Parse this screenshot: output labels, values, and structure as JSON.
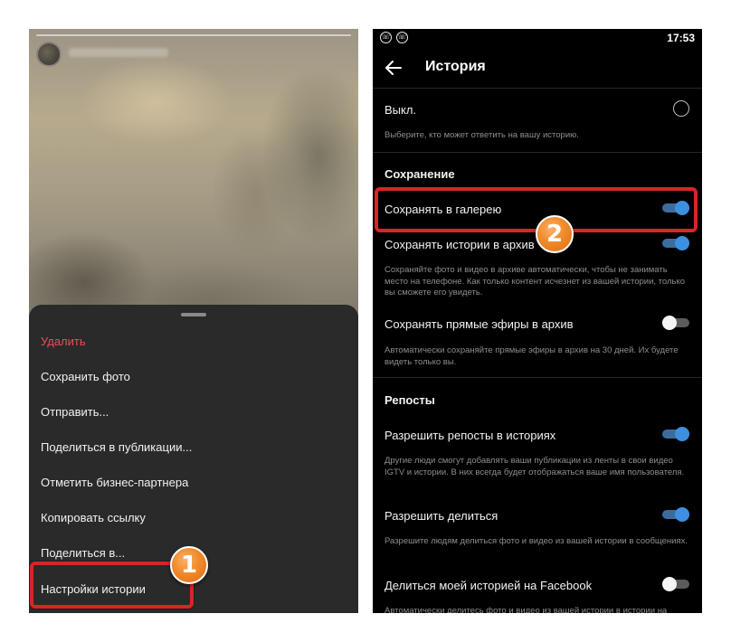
{
  "left_screen": {
    "menu_items": [
      "Удалить",
      "Сохранить фото",
      "Отправить...",
      "Поделиться в публикации...",
      "Отметить бизнес-партнера",
      "Копировать ссылку",
      "Поделиться в...",
      "Настройки истории"
    ],
    "annotation_number": "1"
  },
  "right_screen": {
    "status_time": "17:53",
    "title": "История",
    "off_label": "Выкл.",
    "off_desc": "Выберите, кто может ответить на вашу историю.",
    "section_saving": "Сохранение",
    "save_gallery": "Сохранять в галерею",
    "save_archive": "Сохранять истории в архив",
    "save_archive_desc": "Сохраняйте фото и видео в архиве автоматически, чтобы не занимать место на телефоне. Как только контент исчезнет из вашей истории, только вы сможете его увидеть.",
    "save_live": "Сохранять прямые эфиры в архив",
    "save_live_desc": "Автоматически сохраняйте прямые эфиры в архив на 30 дней. Их будете видеть только вы.",
    "section_reposts": "Репосты",
    "allow_reposts": "Разрешить репосты в историях",
    "allow_reposts_desc": "Другие люди смогут добавлять ваши публикации из ленты в свои видео IGTV и истории. В них всегда будет отображаться ваше имя пользователя.",
    "allow_sharing": "Разрешить делиться",
    "allow_sharing_desc": "Разрешите людям делиться фото и видео из вашей истории в сообщениях.",
    "share_facebook": "Делиться моей историей на Facebook",
    "share_facebook_desc": "Автоматически делитесь фото и видео из вашей истории в истории на",
    "toggles": {
      "save_gallery": true,
      "save_archive": true,
      "save_live": false,
      "allow_reposts": true,
      "allow_sharing": true,
      "share_facebook": false
    },
    "annotation_number": "2"
  },
  "colors": {
    "accent_blue": "#3d8fe0",
    "danger_red": "#ec4d5b",
    "highlight_red": "#d92525",
    "badge_orange": "#f08a2a"
  }
}
